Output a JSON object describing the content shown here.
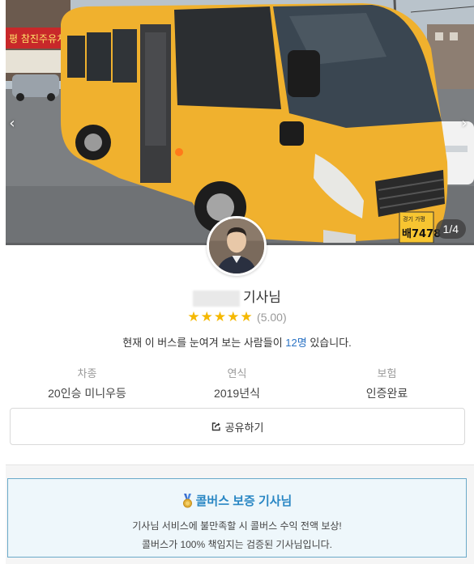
{
  "carousel": {
    "counter": "1/4",
    "prev_icon": "chevron-left-icon",
    "next_icon": "chevron-right-icon",
    "storefront_sign": "평 참진주유치원",
    "license_plate": "배7478",
    "plate_region": "경기 가평"
  },
  "driver": {
    "name_suffix": "기사님",
    "stars": "★★★★★",
    "rating": "(5.00)"
  },
  "viewers": {
    "prefix": "현재 이 버스를 눈여겨 보는 사람들이 ",
    "count": "12명",
    "suffix": " 있습니다."
  },
  "specs": [
    {
      "label": "차종",
      "value": "20인승 미니우등"
    },
    {
      "label": "연식",
      "value": "2019년식"
    },
    {
      "label": "보험",
      "value": "인증완료"
    }
  ],
  "share": {
    "label": "공유하기",
    "icon": "share-icon"
  },
  "guarantee": {
    "title": "콜버스 보증 기사님",
    "line1": "기사님 서비스에 불만족할 시 콜버스 수익 전액 보상!",
    "line2": "콜버스가 100% 책임지는 검증된 기사님입니다.",
    "title_color": "#2a87c4",
    "border_color": "#6aa9c9"
  },
  "colors": {
    "bus": "#f0b12e",
    "accent_blue": "#2a72c4",
    "star": "#f5b800"
  }
}
